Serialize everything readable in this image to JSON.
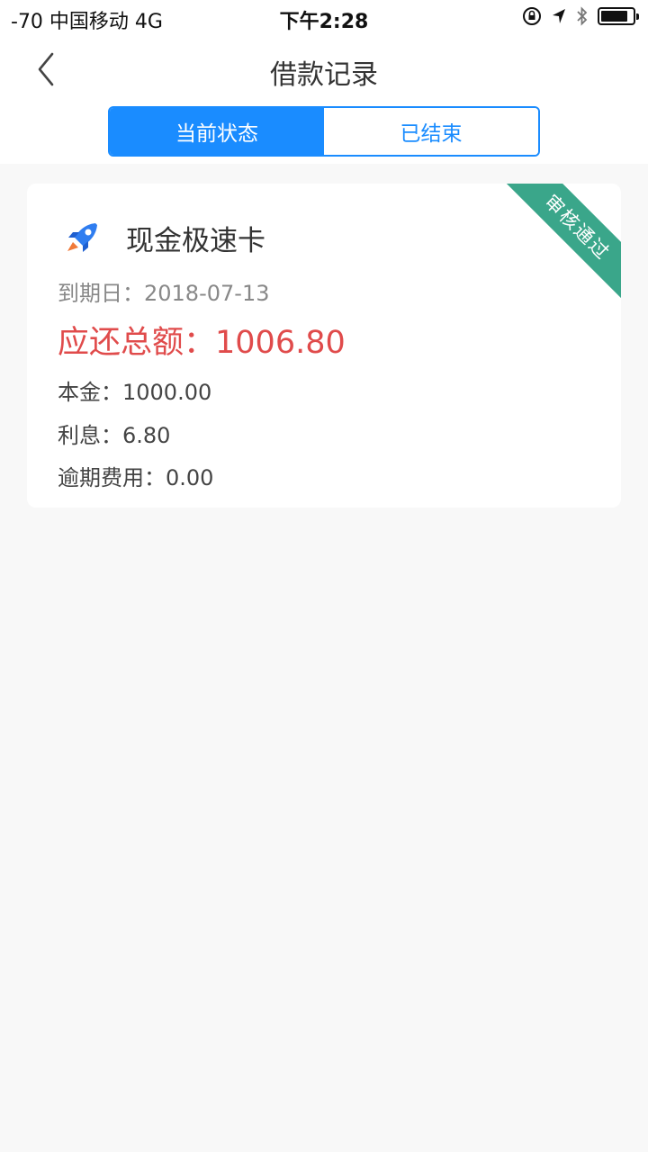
{
  "status_bar": {
    "carrier": "-70 中国移动   4G",
    "time": "下午2:28",
    "battery_level": 0.85
  },
  "nav": {
    "title": "借款记录",
    "back_icon": "chevron-left-icon"
  },
  "tabs": [
    {
      "label": "当前状态",
      "active": true
    },
    {
      "label": "已结束",
      "active": false
    }
  ],
  "loan": {
    "product_name": "现金极速卡",
    "product_icon": "rocket-icon",
    "status": "审核通过",
    "due_label": "到期日：",
    "due_date": "2018-07-13",
    "total_label": "应还总额：",
    "total_value": "1006.80",
    "principal_label": "本金：",
    "principal_value": "1000.00",
    "interest_label": "利息：",
    "interest_value": "6.80",
    "overdue_label": "逾期费用：",
    "overdue_value": "0.00"
  },
  "colors": {
    "primary": "#1a8cff",
    "ribbon": "#3aa68a",
    "amount_red": "#e04b4b"
  }
}
